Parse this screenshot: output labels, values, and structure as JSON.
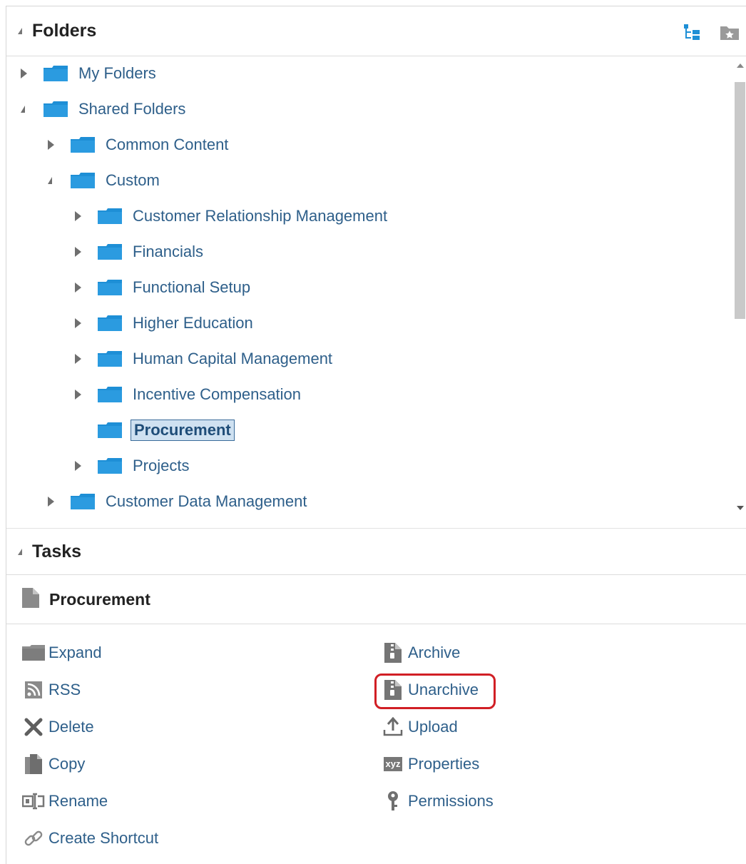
{
  "folders_panel": {
    "title": "Folders",
    "tools": [
      {
        "icon": "tree-view-icon"
      },
      {
        "icon": "favorite-folder-icon"
      }
    ],
    "tree": [
      {
        "label": "My Folders",
        "level": 0,
        "state": "collapsed"
      },
      {
        "label": "Shared Folders",
        "level": 0,
        "state": "expanded"
      },
      {
        "label": "Common Content",
        "level": 1,
        "state": "collapsed"
      },
      {
        "label": "Custom",
        "level": 1,
        "state": "expanded"
      },
      {
        "label": "Customer Relationship Management",
        "level": 2,
        "state": "collapsed"
      },
      {
        "label": "Financials",
        "level": 2,
        "state": "collapsed"
      },
      {
        "label": "Functional Setup",
        "level": 2,
        "state": "collapsed"
      },
      {
        "label": "Higher Education",
        "level": 2,
        "state": "collapsed"
      },
      {
        "label": "Human Capital Management",
        "level": 2,
        "state": "collapsed"
      },
      {
        "label": "Incentive Compensation",
        "level": 2,
        "state": "collapsed"
      },
      {
        "label": "Procurement",
        "level": 2,
        "state": "leaf",
        "selected": true
      },
      {
        "label": "Projects",
        "level": 2,
        "state": "collapsed"
      },
      {
        "label": "Customer Data Management",
        "level": 1,
        "state": "collapsed"
      }
    ]
  },
  "tasks_panel": {
    "title": "Tasks",
    "selected_item": "Procurement",
    "left_tasks": [
      {
        "label": "Expand",
        "icon": "folder-icon"
      },
      {
        "label": "RSS",
        "icon": "rss-icon"
      },
      {
        "label": "Delete",
        "icon": "delete-x-icon"
      },
      {
        "label": "Copy",
        "icon": "copy-icon"
      },
      {
        "label": "Rename",
        "icon": "rename-icon"
      },
      {
        "label": "Create Shortcut",
        "icon": "link-icon"
      }
    ],
    "right_tasks": [
      {
        "label": "Archive",
        "icon": "archive-icon"
      },
      {
        "label": "Unarchive",
        "icon": "unarchive-icon",
        "highlighted": true
      },
      {
        "label": "Upload",
        "icon": "upload-icon"
      },
      {
        "label": "Properties",
        "icon": "xyz-properties-icon",
        "icon_text": "xyz"
      },
      {
        "label": "Permissions",
        "icon": "key-icon"
      }
    ]
  },
  "colors": {
    "link": "#2e5f8a",
    "folder": "#1e8fd6",
    "highlight": "#d11f25",
    "selection": "#cfe1f1"
  }
}
